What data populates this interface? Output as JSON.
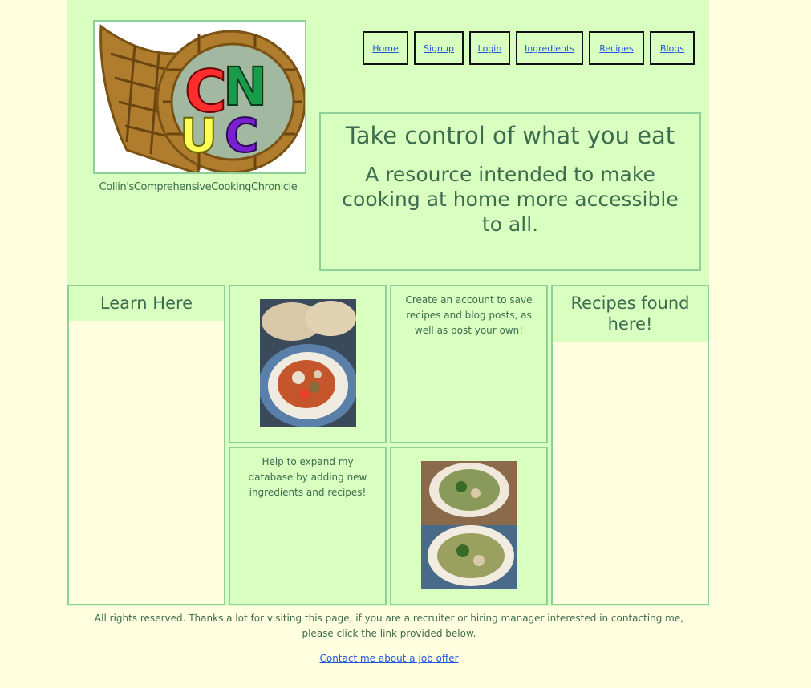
{
  "header": {
    "site_name": "Collin'sComprehensiveCookingChronicle",
    "logo_letters": [
      "C",
      "N",
      "U",
      "C"
    ]
  },
  "nav": {
    "items": [
      "Home",
      "Signup",
      "Login",
      "Ingredients",
      "Recipes",
      "Blogs"
    ]
  },
  "hero": {
    "title": "Take control of what you eat",
    "subtitle": "A resource intended to make cooking at home more accessible to all."
  },
  "grid": {
    "learn_heading": "Learn Here",
    "account_text": "Create an account to save recipes and blog posts, as well as post your own!",
    "expand_text": "Help to expand my database by adding new ingredients and recipes!",
    "recipes_heading": "Recipes found here!"
  },
  "footer": {
    "text": "All rights reserved. Thanks a lot for visiting this page, if you are a recruiter or hiring manager interested in contacting me, please click the link provided below.",
    "link": "Contact me about a job offer"
  },
  "colors": {
    "page_bg": "#ffffdf",
    "panel_bg": "#d8ffbf",
    "border": "#8fcf99",
    "text": "#3d6b4d",
    "link": "#2255dd"
  }
}
